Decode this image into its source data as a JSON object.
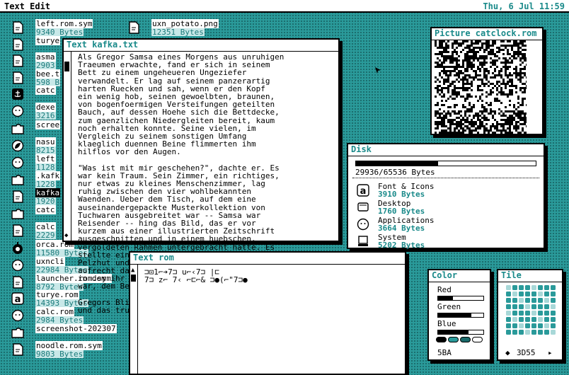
{
  "menubar": {
    "app_name": "Text Edit",
    "datetime": "Thu, 6 Jul 11:59"
  },
  "desktop_icons": [
    {
      "name": "left.rom.sym",
      "size": "9340 Bytes",
      "icon": "document-icon"
    },
    {
      "name": "turye",
      "size": "",
      "icon": "document-icon"
    },
    {
      "name": "asma",
      "size": "2903",
      "icon": "document-icon"
    },
    {
      "name": "bee.t",
      "size": "598 B",
      "icon": "document-icon"
    },
    {
      "name": "catc",
      "size": "",
      "icon": "anchor-app-icon"
    },
    {
      "name": "dexe",
      "size": "3216",
      "icon": "face-icon"
    },
    {
      "name": "scree",
      "size": "",
      "icon": "folder-icon"
    },
    {
      "name": "nasu",
      "size": "8215",
      "icon": "leaf-icon"
    },
    {
      "name": "left",
      "size": "1128",
      "icon": "face-icon"
    },
    {
      "name": ".kafk",
      "size": "1228",
      "icon": "folder-icon"
    },
    {
      "name": "kafka",
      "size": "1920",
      "icon": "document-icon"
    },
    {
      "name": "catc",
      "size": "",
      "icon": "folder-icon"
    },
    {
      "name": "calc",
      "size": "2229",
      "icon": "document-icon"
    },
    {
      "name": "orca.rom",
      "size": "11580 Bytes",
      "icon": "orca-icon"
    },
    {
      "name": "uxncli",
      "size": "22984 Bytes",
      "icon": "face-icon"
    },
    {
      "name": "launcher.rom.sym",
      "size": "8792 Bytes",
      "icon": "document-icon"
    },
    {
      "name": "turye.rom",
      "size": "14393 Bytes",
      "icon": "a-letter-icon"
    },
    {
      "name": "calc.rom",
      "size": "2984 Bytes",
      "icon": "face-icon"
    },
    {
      "name": "screenshot-202307",
      "size": "",
      "icon": "folder-icon"
    },
    {
      "name": "noodle.rom.sym",
      "size": "9803 Bytes",
      "icon": "document-icon"
    }
  ],
  "top_icon2": {
    "name": "uxn_potato.png",
    "size": "12351 Bytes"
  },
  "kafka_window": {
    "title": "Text kafka.txt",
    "lines": [
      "Als Gregor Samsa eines Morgens aus unruhigen",
      "Traeumen erwachte, fand er sich in seinem",
      "Bett zu einem ungeheueren Ungeziefer",
      "verwandelt. Er lag auf seinem panzerartig",
      "harten Ruecken und sah, wenn er den Kopf",
      "ein wenig hob, seinen gewoelbten, braunen,",
      "von bogenfoermigen Versteifungen geteilten",
      "Bauch, auf dessen Hoehe sich die Bettdecke,",
      "zum gaenzlichen Niedergleiten bereit, kaum",
      "noch erhalten konnte. Seine vielen, im",
      "Vergleich zu seinem sonstigen Umfang",
      "klaeglich duennen Beine flimmerten ihm",
      "hilflos vor den Augen.",
      "",
      "\"Was ist mit mir geschehen?\", dachte er. Es",
      "war kein Traum. Sein Zimmer, ein richtiges,",
      "nur etwas zu kleines Menschenzimmer, lag",
      "ruhig zwischen den vier wohlbekannten",
      "Waenden. Ueber dem Tisch, auf dem eine",
      "auseinandergepackte Musterkollektion von",
      "Tuchwaren ausgebreitet war -- Samsa war",
      "Reisender -- hing das Bild, das er vor",
      "kurzem aus einer illustrierten Zeitschrift",
      "ausgeschnitten und in einem huebschen,",
      "vergoldeten Rahmen untergebracht hatte. Es",
      "stellte eine Dame dar, die mit einem",
      "Pelzhut und einer Pelzboa versehen,",
      "aufrecht dasass und einen schweren Pelzmuff,",
      "in dem ihr ganzer Unterarm verschwunden",
      "war, dem Beschauer entgegenhob.",
      "",
      "Gregors Blick richtete sich dann zum Fenster,",
      "und das truebe Wetter -- man hoerte"
    ]
  },
  "picture_window": {
    "title": "Picture catclock.rom"
  },
  "disk_window": {
    "title": "Disk",
    "usage": "29936/65536 Bytes",
    "usage_fraction": 0.457,
    "items": [
      {
        "label": "Font & Icons",
        "size": "3910 Bytes",
        "icon": "a-letter-icon"
      },
      {
        "label": "Desktop",
        "size": "1760 Bytes",
        "icon": "monitor-icon"
      },
      {
        "label": "Applications",
        "size": "3664 Bytes",
        "icon": "face-icon"
      },
      {
        "label": "System",
        "size": "5202 Bytes",
        "icon": "computer-icon"
      }
    ]
  },
  "rom_window": {
    "title": "Text rom",
    "line1": "⊐⊡1⌐➔7⊐ u⌐‹7⊐ |⊏",
    "line2": "7⊐ z⌐ 7‹ ⌐⊏⌐& ⊐●(⌐\"7⊐●"
  },
  "color_window": {
    "title": "Color",
    "channels": [
      {
        "label": "Red",
        "fraction": 0.33
      },
      {
        "label": "Green",
        "fraction": 0.73
      },
      {
        "label": "Blue",
        "fraction": 0.67
      }
    ],
    "swatches": [
      "#000000",
      "#2a9a9a",
      "#1a6a6a",
      "#ffffff"
    ],
    "value": "5BA"
  },
  "tile_window": {
    "title": "Tile",
    "value": "3D55",
    "prev": "◆",
    "next": "▸"
  },
  "colors": {
    "teal": "#2a9a9a",
    "dark_teal": "#1a6a6a",
    "label_teal": "#1a8a8a"
  }
}
